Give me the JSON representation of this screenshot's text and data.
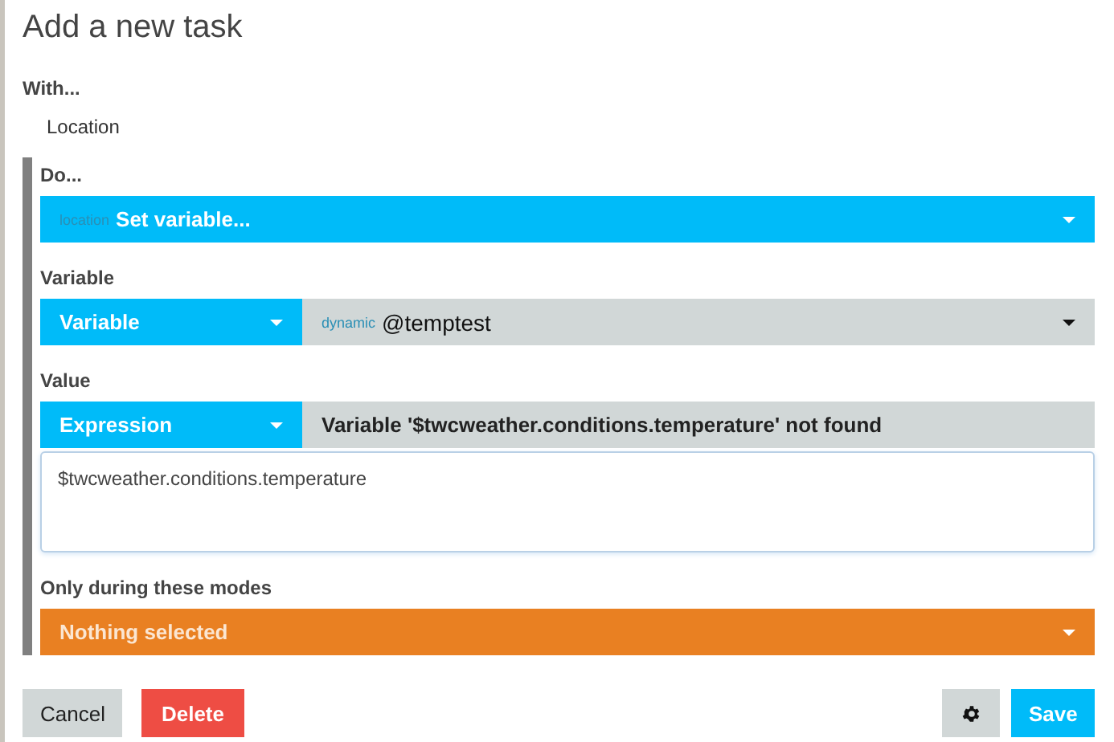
{
  "title": "Add a new task",
  "with": {
    "label": "With...",
    "value": "Location"
  },
  "do": {
    "label": "Do...",
    "dropdown": {
      "tag": "location",
      "value": "Set variable..."
    }
  },
  "variable": {
    "label": "Variable",
    "type_dropdown": "Variable",
    "target": {
      "tag": "dynamic",
      "value": "@temptest"
    }
  },
  "value": {
    "label": "Value",
    "type_dropdown": "Expression",
    "error": "Variable '$twcweather.conditions.temperature' not found",
    "expression": "$twcweather.conditions.temperature"
  },
  "modes": {
    "label": "Only during these modes",
    "dropdown": "Nothing selected"
  },
  "buttons": [
    {
      "kind": "text",
      "label": "Cancel"
    },
    {
      "kind": "danger",
      "label": "Delete"
    },
    {
      "kind": "settings"
    },
    {
      "kind": "primary",
      "label": "Save"
    }
  ]
}
